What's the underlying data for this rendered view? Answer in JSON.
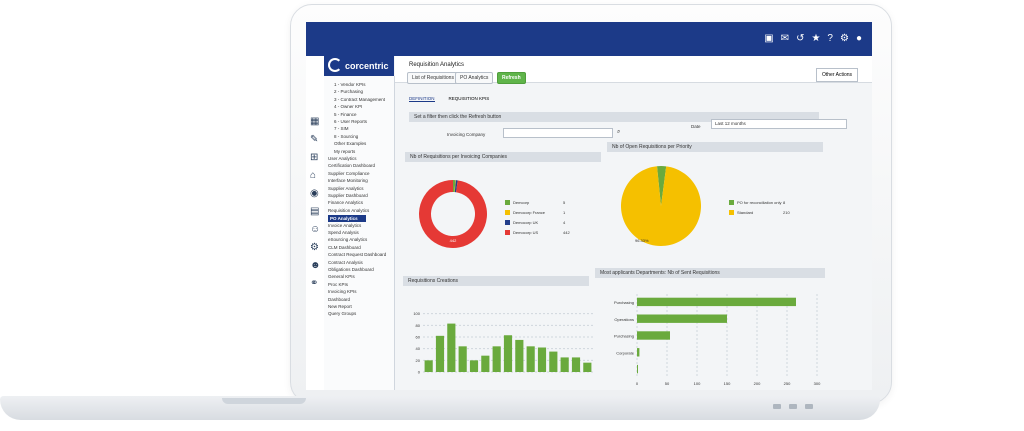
{
  "app": {
    "brand": "corcentric",
    "title": "Requisition Analytics",
    "toolbar": {
      "btn_list": "List of Requisitions",
      "btn_po": "PO Analytics",
      "btn_refresh": "Refresh",
      "other_actions": "Other Actions"
    },
    "tabs": [
      {
        "label": "DEFINITION"
      },
      {
        "label": "REQUISITION KPIS"
      }
    ],
    "filter": {
      "header": "Set a filter then click the Refresh button",
      "invoicing_label": "Invoicing Company",
      "date_label": "Date",
      "date_value": "Last 12 months"
    }
  },
  "sidebar": {
    "items": [
      {
        "label": "1 - Vendor KPIs"
      },
      {
        "label": "2 - Purchasing"
      },
      {
        "label": "3 - Contract Management"
      },
      {
        "label": "4 - Owner KPI"
      },
      {
        "label": "5 - Finance"
      },
      {
        "label": "6 - User Reports"
      },
      {
        "label": "7 - SIM"
      },
      {
        "label": "8 - Sourcing"
      },
      {
        "label": "Other Examples"
      },
      {
        "label": "My reports"
      },
      {
        "label": "User Analytics"
      },
      {
        "label": "Certification Dashboard"
      },
      {
        "label": "Supplier Compliance"
      },
      {
        "label": "Interface Monitoring"
      },
      {
        "label": "Supplier Analytics"
      },
      {
        "label": "Supplier Dashboard"
      },
      {
        "label": "Finance Analytics"
      },
      {
        "label": "Requisition Analytics"
      },
      {
        "label": "PO Analytics"
      },
      {
        "label": "Invoice Analytics"
      },
      {
        "label": "Spend Analysis"
      },
      {
        "label": "eSourcing Analytics"
      },
      {
        "label": "CLM Dashboard"
      },
      {
        "label": "Contract Request Dashboard"
      },
      {
        "label": "Contract Analysis"
      },
      {
        "label": "Obligations Dashboard"
      },
      {
        "label": "General KPIs"
      },
      {
        "label": "Proc KPIs"
      },
      {
        "label": "Invoicing KPIs"
      },
      {
        "label": "Dashboard"
      },
      {
        "label": "New Report"
      },
      {
        "label": "Query Groups"
      }
    ]
  },
  "panels": {
    "nb_req": "Nb of Requisitions per Invoicing Companies",
    "nb_open": "Nb of Open Requisitions per Priority",
    "creations": "Requisitions Creations",
    "departments": "Most applicants Departments: Nb of Sent Requisitions"
  },
  "colors": {
    "nav": "#1c3a88",
    "green": "#6aaa3d",
    "yellow": "#f5c000",
    "blue": "#223d8a",
    "red": "#e53935"
  },
  "chart_data": [
    {
      "type": "pie",
      "title": "Nb of Requisitions per Invoicing Companies",
      "labels": [
        "Demcorp",
        "Democorp France",
        "Democorp UK",
        "Democorp US"
      ],
      "values": [
        5,
        1,
        4,
        442
      ],
      "colors": [
        "#6aaa3d",
        "#f5c000",
        "#223d8a",
        "#e53935"
      ],
      "center_label": "442"
    },
    {
      "type": "pie",
      "title": "Nb of Open Requisitions per Priority",
      "labels": [
        "PO for reconciliation only",
        "Standard"
      ],
      "values": [
        8,
        210
      ],
      "colors": [
        "#6aaa3d",
        "#f5c000"
      ],
      "center_label": "96.33%"
    },
    {
      "type": "bar",
      "title": "Requisitions Creations",
      "ylim": [
        0,
        120
      ],
      "yticks": [
        0,
        20,
        40,
        60,
        80,
        100
      ],
      "values": [
        20,
        62,
        83,
        44,
        20,
        28,
        44,
        63,
        55,
        44,
        42,
        35,
        25,
        25,
        16
      ]
    },
    {
      "type": "bar",
      "orientation": "horizontal",
      "title": "Most applicants Departments: Nb of Sent Requisitions",
      "categories": [
        "Purchasing",
        "Operations",
        "Purchasing",
        "Corporate",
        ""
      ],
      "values": [
        265,
        150,
        55,
        4,
        1
      ],
      "xlim": [
        0,
        300
      ],
      "xticks": [
        0,
        50,
        100,
        150,
        200,
        250,
        300
      ]
    }
  ]
}
